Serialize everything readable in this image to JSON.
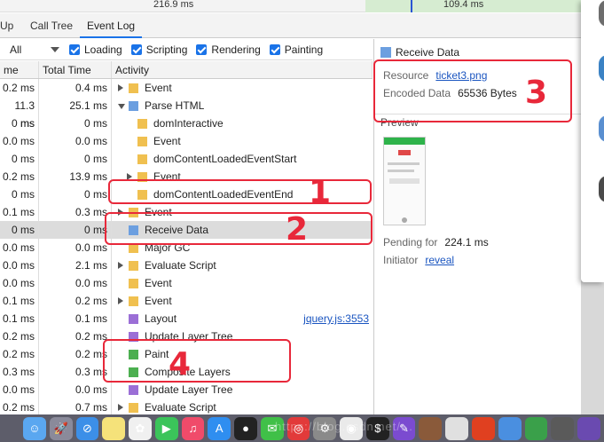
{
  "timing": {
    "left_value": "216.9 ms",
    "right_value": "109.4 ms"
  },
  "tabs": [
    {
      "label": "Up"
    },
    {
      "label": "Call Tree"
    },
    {
      "label": "Event Log"
    }
  ],
  "filters": {
    "scope": "All",
    "checkboxes": [
      {
        "label": "Loading",
        "checked": true
      },
      {
        "label": "Scripting",
        "checked": true
      },
      {
        "label": "Rendering",
        "checked": true
      },
      {
        "label": "Painting",
        "checked": true
      }
    ]
  },
  "table": {
    "headers": {
      "self_time": "me",
      "total_time": "Total Time",
      "activity": "Activity"
    },
    "rows": [
      {
        "self": "0.2 ms",
        "total": "0.4 ms",
        "activity": "Event",
        "indent": 0,
        "toggle": "right",
        "color": "#f0c050",
        "link": ""
      },
      {
        "self": "11.3 ms",
        "total": "25.1 ms",
        "activity": "Parse HTML",
        "indent": 0,
        "toggle": "down",
        "color": "#6c9fe0",
        "link": ""
      },
      {
        "self": "0 ms",
        "total": "0 ms",
        "activity": "domInteractive",
        "indent": 1,
        "toggle": "",
        "color": "#f0c050",
        "link": ""
      },
      {
        "self": "0.0 ms",
        "total": "0.0 ms",
        "activity": "Event",
        "indent": 1,
        "toggle": "",
        "color": "#f0c050",
        "link": ""
      },
      {
        "self": "0 ms",
        "total": "0 ms",
        "activity": "domContentLoadedEventStart",
        "indent": 1,
        "toggle": "",
        "color": "#f0c050",
        "link": ""
      },
      {
        "self": "0.2 ms",
        "total": "13.9 ms",
        "activity": "Event",
        "indent": 1,
        "toggle": "right",
        "color": "#f0c050",
        "link": ""
      },
      {
        "self": "0 ms",
        "total": "0 ms",
        "activity": "domContentLoadedEventEnd",
        "indent": 1,
        "toggle": "",
        "color": "#f0c050",
        "link": ""
      },
      {
        "self": "0.1 ms",
        "total": "0.3 ms",
        "activity": "Event",
        "indent": 0,
        "toggle": "right",
        "color": "#f0c050",
        "link": ""
      },
      {
        "self": "0 ms",
        "total": "0 ms",
        "activity": "Receive Data",
        "indent": 0,
        "toggle": "",
        "color": "#6c9fe0",
        "link": "",
        "selected": true
      },
      {
        "self": "0.0 ms",
        "total": "0.0 ms",
        "activity": "Major GC",
        "indent": 0,
        "toggle": "",
        "color": "#f0c050",
        "link": ""
      },
      {
        "self": "0.0 ms",
        "total": "2.1 ms",
        "activity": "Evaluate Script",
        "indent": 0,
        "toggle": "right",
        "color": "#f0c050",
        "link": ""
      },
      {
        "self": "0.0 ms",
        "total": "0.0 ms",
        "activity": "Event",
        "indent": 0,
        "toggle": "",
        "color": "#f0c050",
        "link": ""
      },
      {
        "self": "0.1 ms",
        "total": "0.2 ms",
        "activity": "Event",
        "indent": 0,
        "toggle": "right",
        "color": "#f0c050",
        "link": ""
      },
      {
        "self": "0.1 ms",
        "total": "0.1 ms",
        "activity": "Layout",
        "indent": 0,
        "toggle": "",
        "color": "#9b6fd6",
        "link": "jquery.js:3553"
      },
      {
        "self": "0.2 ms",
        "total": "0.2 ms",
        "activity": "Update Layer Tree",
        "indent": 0,
        "toggle": "",
        "color": "#9b6fd6",
        "link": ""
      },
      {
        "self": "0.2 ms",
        "total": "0.2 ms",
        "activity": "Paint",
        "indent": 0,
        "toggle": "",
        "color": "#4caf50",
        "link": ""
      },
      {
        "self": "0.3 ms",
        "total": "0.3 ms",
        "activity": "Composite Layers",
        "indent": 0,
        "toggle": "",
        "color": "#4caf50",
        "link": ""
      },
      {
        "self": "0.0 ms",
        "total": "0.0 ms",
        "activity": "Update Layer Tree",
        "indent": 0,
        "toggle": "",
        "color": "#9b6fd6",
        "link": ""
      },
      {
        "self": "0.2 ms",
        "total": "0.7 ms",
        "activity": "Evaluate Script",
        "indent": 0,
        "toggle": "right",
        "color": "#f0c050",
        "link": ""
      }
    ]
  },
  "details": {
    "title": "Receive Data",
    "resource_label": "Resource",
    "resource_value": "ticket3.png",
    "encoded_label": "Encoded Data",
    "encoded_value": "65536 Bytes",
    "preview_label": "Preview",
    "pending_label": "Pending for",
    "pending_value": "224.1 ms",
    "initiator_label": "Initiator",
    "initiator_value": "reveal"
  },
  "annotations": [
    "1",
    "2",
    "3",
    "4"
  ],
  "dock": {
    "icons": [
      "finder-icon",
      "launchpad-icon",
      "safari-icon",
      "notes-icon",
      "photos-icon",
      "facetime-icon",
      "music-icon",
      "appstore-icon",
      "qq-icon",
      "wechat-icon",
      "netease-music-icon",
      "system-preferences-icon",
      "chrome-icon",
      "terminal-icon",
      "editor-icon",
      "app-icon",
      "app-icon-2",
      "app-icon-3",
      "app-icon-4",
      "app-icon-5",
      "app-icon-6",
      "app-icon-7"
    ],
    "watermark": "https://blog.csdn.net/..."
  }
}
